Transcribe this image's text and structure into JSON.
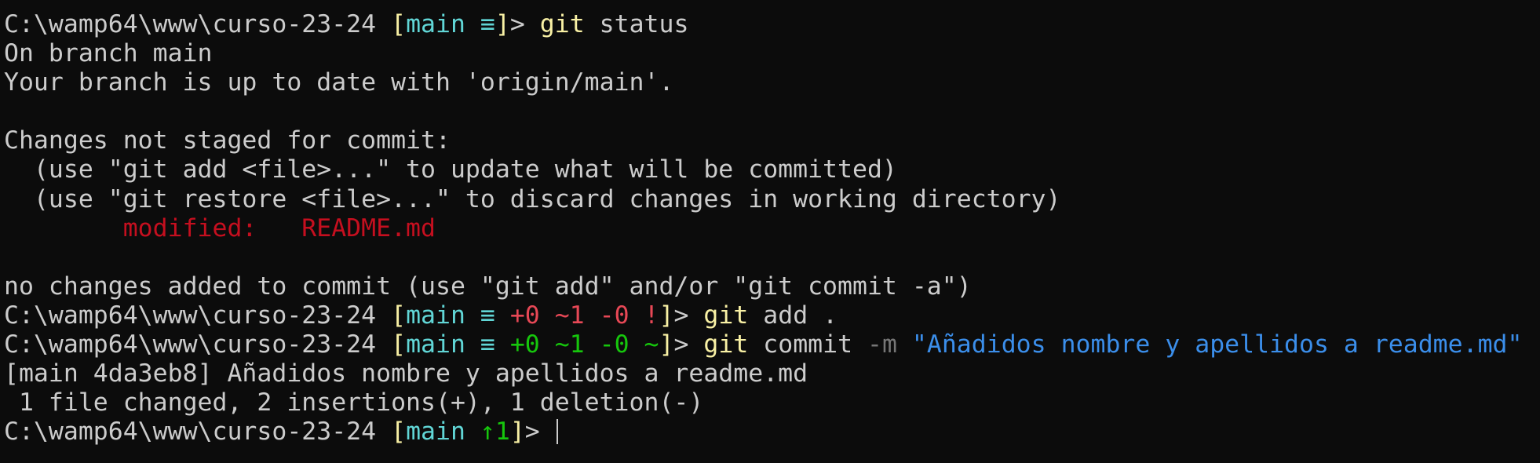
{
  "colors": {
    "background": "#0c0c0c",
    "foreground": "#cccccc",
    "prompt_bracket": "#f9f1a5",
    "branch": "#61d6d6",
    "command": "#f9f1a5",
    "modified": "#c50f1f",
    "dirty": "#e74856",
    "staged": "#16c60c",
    "flag": "#767676",
    "string": "#3b8eea"
  },
  "lines": [
    [
      {
        "t": "C:\\wamp64\\www\\curso-23-24 ",
        "c": "default"
      },
      {
        "t": "[",
        "c": "yellow"
      },
      {
        "t": "main ≡",
        "c": "cyan"
      },
      {
        "t": "]",
        "c": "yellow"
      },
      {
        "t": "> ",
        "c": "default"
      },
      {
        "t": "git",
        "c": "yellow"
      },
      {
        "t": " status",
        "c": "default"
      }
    ],
    [
      {
        "t": "On branch main",
        "c": "default"
      }
    ],
    [
      {
        "t": "Your branch is up to date with 'origin/main'.",
        "c": "default"
      }
    ],
    [],
    [
      {
        "t": "Changes not staged for commit:",
        "c": "default"
      }
    ],
    [
      {
        "t": "  (use \"git add <file>...\" to update what will be committed)",
        "c": "default"
      }
    ],
    [
      {
        "t": "  (use \"git restore <file>...\" to discard changes in working directory)",
        "c": "default"
      }
    ],
    [
      {
        "t": "        modified:   README.md",
        "c": "darkred"
      }
    ],
    [],
    [
      {
        "t": "no changes added to commit (use \"git add\" and/or \"git commit -a\")",
        "c": "default"
      }
    ],
    [
      {
        "t": "C:\\wamp64\\www\\curso-23-24 ",
        "c": "default"
      },
      {
        "t": "[",
        "c": "yellow"
      },
      {
        "t": "main ≡ ",
        "c": "cyan"
      },
      {
        "t": "+0 ~1 -0 !",
        "c": "red"
      },
      {
        "t": "]",
        "c": "yellow"
      },
      {
        "t": "> ",
        "c": "default"
      },
      {
        "t": "git",
        "c": "yellow"
      },
      {
        "t": " add .",
        "c": "default"
      }
    ],
    [
      {
        "t": "C:\\wamp64\\www\\curso-23-24 ",
        "c": "default"
      },
      {
        "t": "[",
        "c": "yellow"
      },
      {
        "t": "main ≡ ",
        "c": "cyan"
      },
      {
        "t": "+0 ~1 -0 ~",
        "c": "green"
      },
      {
        "t": "]",
        "c": "yellow"
      },
      {
        "t": "> ",
        "c": "default"
      },
      {
        "t": "git",
        "c": "yellow"
      },
      {
        "t": " commit ",
        "c": "default"
      },
      {
        "t": "-m",
        "c": "gray"
      },
      {
        "t": " \"Añadidos nombre y apellidos a readme.md\"",
        "c": "blue"
      }
    ],
    [
      {
        "t": "[main 4da3eb8] Añadidos nombre y apellidos a readme.md",
        "c": "default"
      }
    ],
    [
      {
        "t": " 1 file changed, 2 insertions(+), 1 deletion(-)",
        "c": "default"
      }
    ],
    [
      {
        "t": "C:\\wamp64\\www\\curso-23-24 ",
        "c": "default"
      },
      {
        "t": "[",
        "c": "yellow"
      },
      {
        "t": "main ",
        "c": "cyan"
      },
      {
        "t": "↑1",
        "c": "green"
      },
      {
        "t": "]",
        "c": "yellow"
      },
      {
        "t": "> ",
        "c": "default"
      }
    ]
  ],
  "cursor_on_last_line": true
}
